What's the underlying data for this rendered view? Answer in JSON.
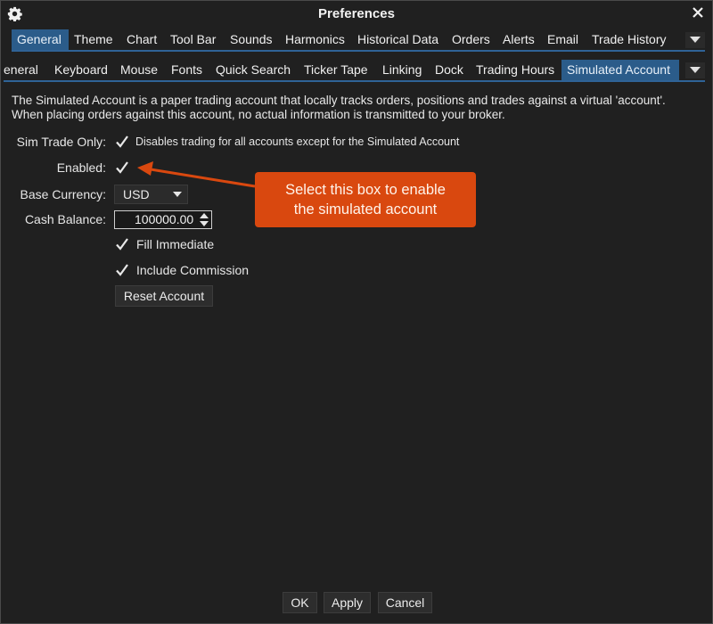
{
  "window": {
    "title": "Preferences"
  },
  "tabs_row1": [
    {
      "label": "General",
      "active": true
    },
    {
      "label": "Theme"
    },
    {
      "label": "Chart"
    },
    {
      "label": "Tool Bar"
    },
    {
      "label": "Sounds"
    },
    {
      "label": "Harmonics"
    },
    {
      "label": "Historical Data"
    },
    {
      "label": "Orders"
    },
    {
      "label": "Alerts"
    },
    {
      "label": "Email"
    },
    {
      "label": "Trade History"
    }
  ],
  "tabs_row2": [
    {
      "label": "eneral"
    },
    {
      "label": "Keyboard"
    },
    {
      "label": "Mouse"
    },
    {
      "label": "Fonts"
    },
    {
      "label": "Quick Search"
    },
    {
      "label": "Ticker Tape"
    },
    {
      "label": "Linking"
    },
    {
      "label": "Dock"
    },
    {
      "label": "Trading Hours"
    },
    {
      "label": "Simulated Account",
      "active": true
    }
  ],
  "description": {
    "line1": "The Simulated Account is a paper trading account that locally tracks orders, positions and trades against a virtual 'account'.",
    "line2": "When placing orders against this account, no actual information is transmitted to your broker."
  },
  "form": {
    "sim_trade_only": {
      "label": "Sim Trade Only:",
      "checked": true,
      "text": "Disables trading for all accounts except for the Simulated Account"
    },
    "enabled": {
      "label": "Enabled:",
      "checked": true
    },
    "base_currency": {
      "label": "Base Currency:",
      "value": "USD"
    },
    "cash_balance": {
      "label": "Cash Balance:",
      "value": "100000.00"
    },
    "fill_immediate": {
      "label": "Fill Immediate",
      "checked": true
    },
    "include_commission": {
      "label": "Include Commission",
      "checked": true
    },
    "reset_button": "Reset Account"
  },
  "callout": {
    "line1": "Select this box to enable",
    "line2": "the simulated account",
    "color": "#d9480f"
  },
  "footer": {
    "ok": "OK",
    "apply": "Apply",
    "cancel": "Cancel"
  },
  "colors": {
    "accent": "#2b5c8a",
    "background": "#202020"
  }
}
